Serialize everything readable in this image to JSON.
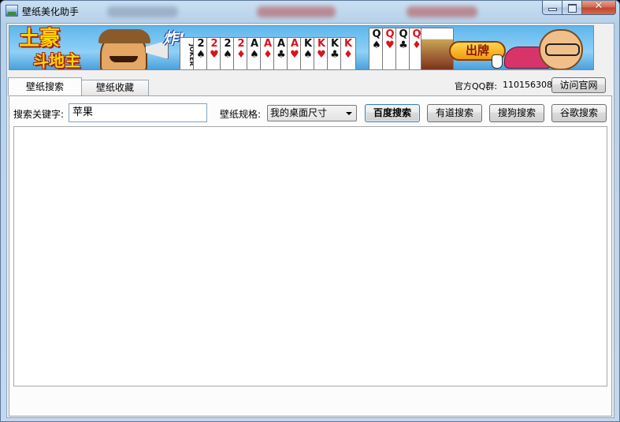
{
  "window": {
    "title": "壁纸美化助手",
    "close_glyph": "✕"
  },
  "banner": {
    "brand_line1": "土豪",
    "brand_line2": "斗地主",
    "boom": "炸!",
    "play_button": "出牌",
    "cards": [
      {
        "rank": "JOKER",
        "color": "black"
      },
      {
        "rank": "2",
        "suit": "♠",
        "color": "black"
      },
      {
        "rank": "2",
        "suit": "♥",
        "color": "red"
      },
      {
        "rank": "2",
        "suit": "♠",
        "color": "black"
      },
      {
        "rank": "2",
        "suit": "♦",
        "color": "red"
      },
      {
        "rank": "A",
        "suit": "♠",
        "color": "black"
      },
      {
        "rank": "A",
        "suit": "♦",
        "color": "red"
      },
      {
        "rank": "A",
        "suit": "♣",
        "color": "black"
      },
      {
        "rank": "A",
        "suit": "♥",
        "color": "red"
      },
      {
        "rank": "K",
        "suit": "♠",
        "color": "black"
      },
      {
        "rank": "K",
        "suit": "♥",
        "color": "red"
      },
      {
        "rank": "K",
        "suit": "♣",
        "color": "black"
      },
      {
        "rank": "K",
        "suit": "♦",
        "color": "red"
      }
    ],
    "queens": [
      {
        "rank": "Q",
        "suit": "♠",
        "color": "black"
      },
      {
        "rank": "Q",
        "suit": "♥",
        "color": "red"
      },
      {
        "rank": "Q",
        "suit": "♣",
        "color": "black"
      },
      {
        "rank": "Q",
        "suit": "♦",
        "color": "red"
      }
    ]
  },
  "tabs": [
    {
      "label": "壁纸搜索",
      "active": true
    },
    {
      "label": "壁纸收藏",
      "active": false
    }
  ],
  "header": {
    "qq_label": "官方QQ群:",
    "qq_number": "110156308",
    "visit_button": "访问官网"
  },
  "search": {
    "keyword_label": "搜索关键字:",
    "keyword_value": "苹果",
    "spec_label": "壁纸规格:",
    "spec_selected": "我的桌面尺寸",
    "buttons": {
      "baidu": "百度搜索",
      "youdao": "有道搜索",
      "sogou": "搜狗搜索",
      "google": "谷歌搜索"
    }
  },
  "colors": {
    "titlebar": "#b9d1ea",
    "client_bg": "#f0f0f0",
    "close_button": "#c0452b"
  }
}
